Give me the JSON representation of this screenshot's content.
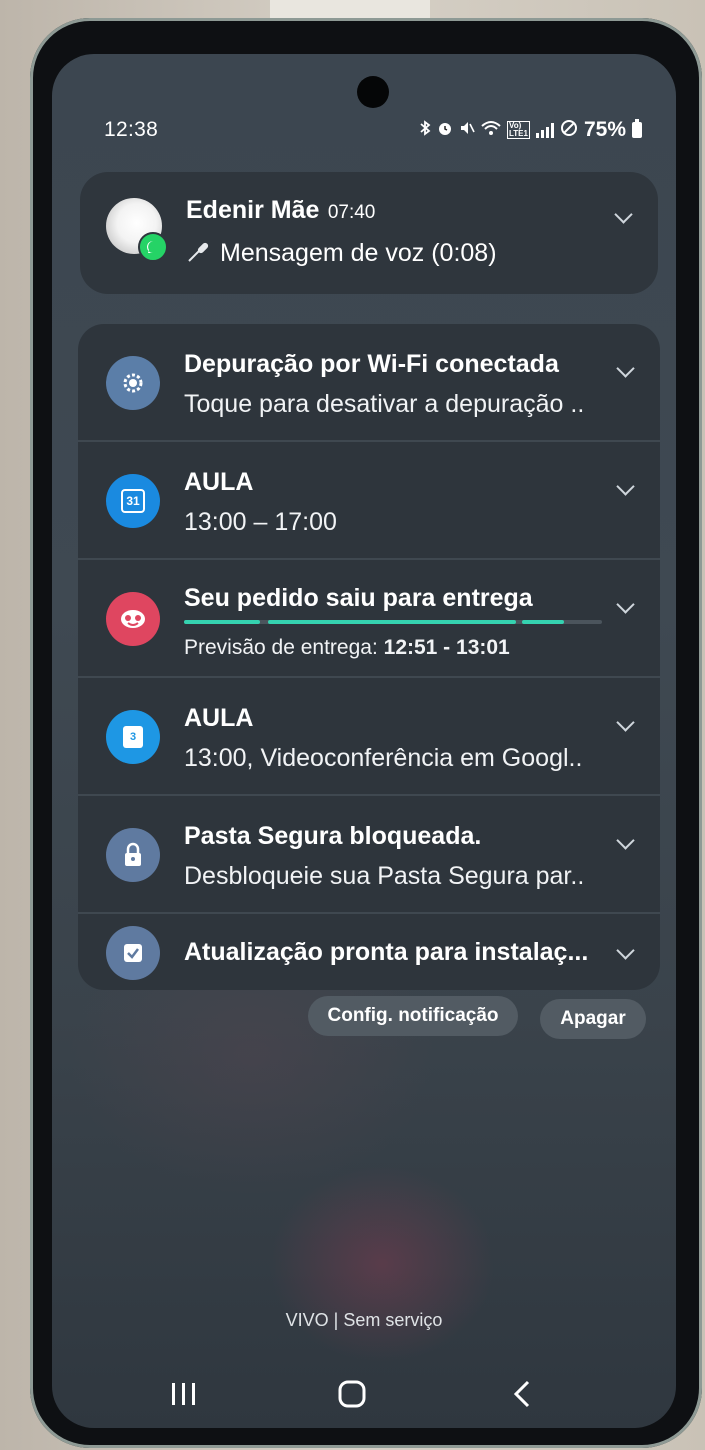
{
  "status_bar": {
    "time": "12:38",
    "battery": "75%",
    "icons": [
      "bluetooth-icon",
      "alarm-icon",
      "mute-icon",
      "wifi-icon",
      "volte-icon",
      "signal-icon",
      "do-not-disturb-icon",
      "battery-icon"
    ]
  },
  "notifications": {
    "message": {
      "sender": "Edenir Mãe",
      "time": "07:40",
      "body": "Mensagem de voz (0:08)",
      "app_badge": "whatsapp-icon"
    },
    "items": [
      {
        "title": "Depuração por Wi-Fi conectada",
        "subtitle": "Toque para desativar a depuração ..",
        "icon": "gear-icon",
        "color": "#5b7ea8"
      },
      {
        "title": "AULA",
        "subtitle": "13:00 – 17:00",
        "icon": "calendar-icon",
        "icon_text": "31",
        "color": "#1a8ae0"
      },
      {
        "title": "Seu pedido saiu para entrega",
        "subtitle_label": "Previsão de entrega:",
        "subtitle_value": "12:51 - 13:01",
        "icon": "delivery-icon",
        "color": "#df4660",
        "progress": 0.91
      },
      {
        "title": "AULA",
        "subtitle": "13:00, Videoconferência em Googl..",
        "icon": "calendar-icon",
        "icon_text": "3",
        "color": "#1e97e4"
      },
      {
        "title": "Pasta Segura bloqueada.",
        "subtitle": "Desbloqueie sua Pasta Segura par..",
        "icon": "lock-icon",
        "color": "#5f7aa0"
      },
      {
        "title": "Atualização pronta para instalaç...",
        "icon": "update-icon",
        "color": "#5f7aa0"
      }
    ]
  },
  "actions": {
    "settings": "Config. notificação",
    "clear": "Apagar"
  },
  "carrier": "VIVO | Sem serviço"
}
